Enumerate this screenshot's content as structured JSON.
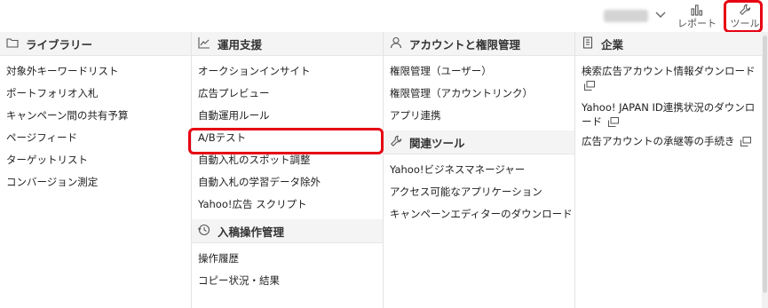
{
  "header": {
    "report_label": "レポート",
    "tool_label": "ツール",
    "highlight_color": "#e60012"
  },
  "columns": [
    {
      "title": "ライブラリー",
      "icon": "folder-icon",
      "items": [
        "対象外キーワードリスト",
        "ポートフォリオ入札",
        "キャンペーン間の共有予算",
        "ページフィード",
        "ターゲットリスト",
        "コンバージョン測定"
      ]
    },
    {
      "title": "運用支援",
      "icon": "line-chart-icon",
      "items": [
        "オークションインサイト",
        "広告プレビュー",
        "自動運用ルール",
        "A/Bテスト",
        "自動入札のスポット調整",
        "自動入札の学習データ除外",
        "Yahoo!広告 スクリプト"
      ],
      "sub_section": {
        "title": "入稿操作管理",
        "icon": "history-icon",
        "items": [
          "操作履歴",
          "コピー状況・結果"
        ]
      }
    },
    {
      "title": "アカウントと権限管理",
      "icon": "person-icon",
      "items": [
        "権限管理（ユーザー）",
        "権限管理（アカウントリンク）",
        "アプリ連携"
      ],
      "sub_section": {
        "title": "関連ツール",
        "icon": "wrench-icon",
        "items": [
          "Yahoo!ビジネスマネージャー",
          "アクセス可能なアプリケーション",
          "キャンペーンエディターのダウンロード"
        ]
      }
    },
    {
      "title": "企業",
      "icon": "building-icon",
      "items": [
        "検索広告アカウント情報ダウンロード",
        "Yahoo! JAPAN ID連携状況のダウンロード",
        "広告アカウントの承継等の手続き"
      ]
    }
  ]
}
